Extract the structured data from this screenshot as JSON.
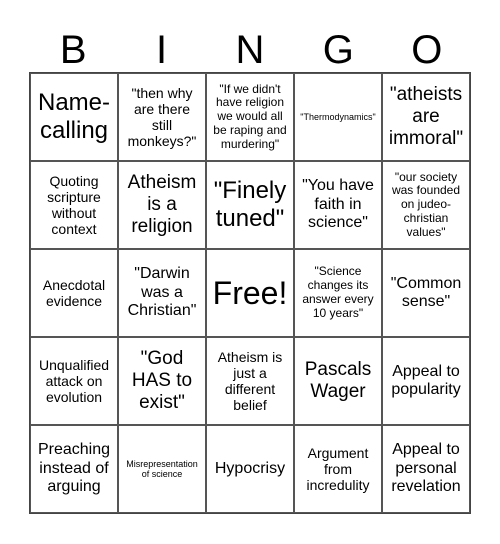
{
  "header": {
    "letters": [
      "B",
      "I",
      "N",
      "G",
      "O"
    ]
  },
  "cells": [
    [
      "Name-calling",
      "\"then why are there still monkeys?\"",
      "\"If we didn't have religion we would all be raping and murdering\"",
      "\"Thermodynamics\"",
      "\"atheists are immoral\""
    ],
    [
      "Quoting scripture without context",
      "Atheism is a religion",
      "\"Finely tuned\"",
      "\"You have faith in science\"",
      "\"our society was founded on judeo-christian values\""
    ],
    [
      "Anecdotal evidence",
      "\"Darwin was a Christian\"",
      "Free!",
      "\"Science changes its answer every 10 years\"",
      "\"Common sense\""
    ],
    [
      "Unqualified attack on evolution",
      "\"God HAS to exist\"",
      "Atheism is just a different belief",
      "Pascals Wager",
      "Appeal to popularity"
    ],
    [
      "Preaching instead of arguing",
      "Misrepresentation of science",
      "Hypocrisy",
      "Argument from incredulity",
      "Appeal to personal revelation"
    ]
  ]
}
